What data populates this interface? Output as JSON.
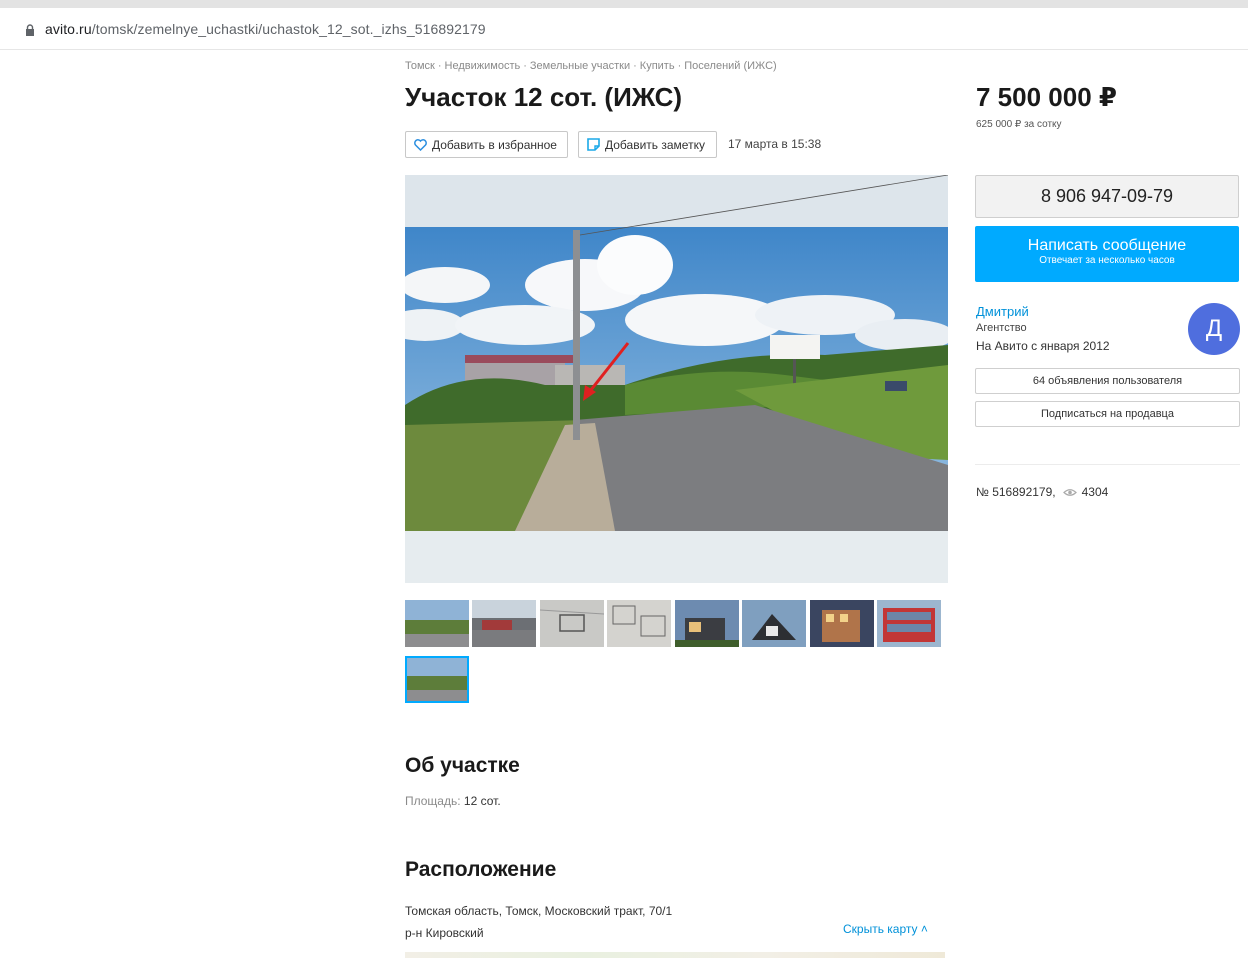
{
  "browser": {
    "url_host": "avito.ru",
    "url_path": "/tomsk/zemelnye_uchastki/uchastok_12_sot._izhs_516892179"
  },
  "breadcrumbs": [
    "Томск",
    "Недвижимость",
    "Земельные участки",
    "Купить",
    "Поселений (ИЖС)"
  ],
  "listing": {
    "title": "Участок 12 сот. (ИЖС)",
    "favorite_label": "Добавить в избранное",
    "note_label": "Добавить заметку",
    "date": "17 марта в 15:38"
  },
  "gallery": {
    "thumbnail_count": 9,
    "active_index": 8
  },
  "about": {
    "heading": "Об участке",
    "area_label": "Площадь:",
    "area_value": "12 сот."
  },
  "location": {
    "heading": "Расположение",
    "address": "Томская область, Томск, Московский тракт, 70/1",
    "district": "р-н Кировский",
    "hide_map": "Скрыть карту"
  },
  "sidebar": {
    "price": "7 500 000 ₽",
    "price_per": "625 000 ₽ за сотку",
    "phone": "8 906 947-09-79",
    "message_label": "Написать сообщение",
    "message_sub": "Отвечает за несколько часов",
    "seller_name": "Дмитрий",
    "seller_type": "Агентство",
    "seller_since": "На Авито с января 2012",
    "avatar_letter": "Д",
    "ads_button": "64 объявления пользователя",
    "subscribe_button": "Подписаться на продавца",
    "ad_number": "№ 516892179,",
    "views": "4304"
  },
  "colors": {
    "accent": "#00aaff",
    "link": "#0091d9",
    "avatar": "#4f6ede",
    "favorite_icon": "#2c8fe0",
    "note_icon": "#1aa9e8"
  }
}
